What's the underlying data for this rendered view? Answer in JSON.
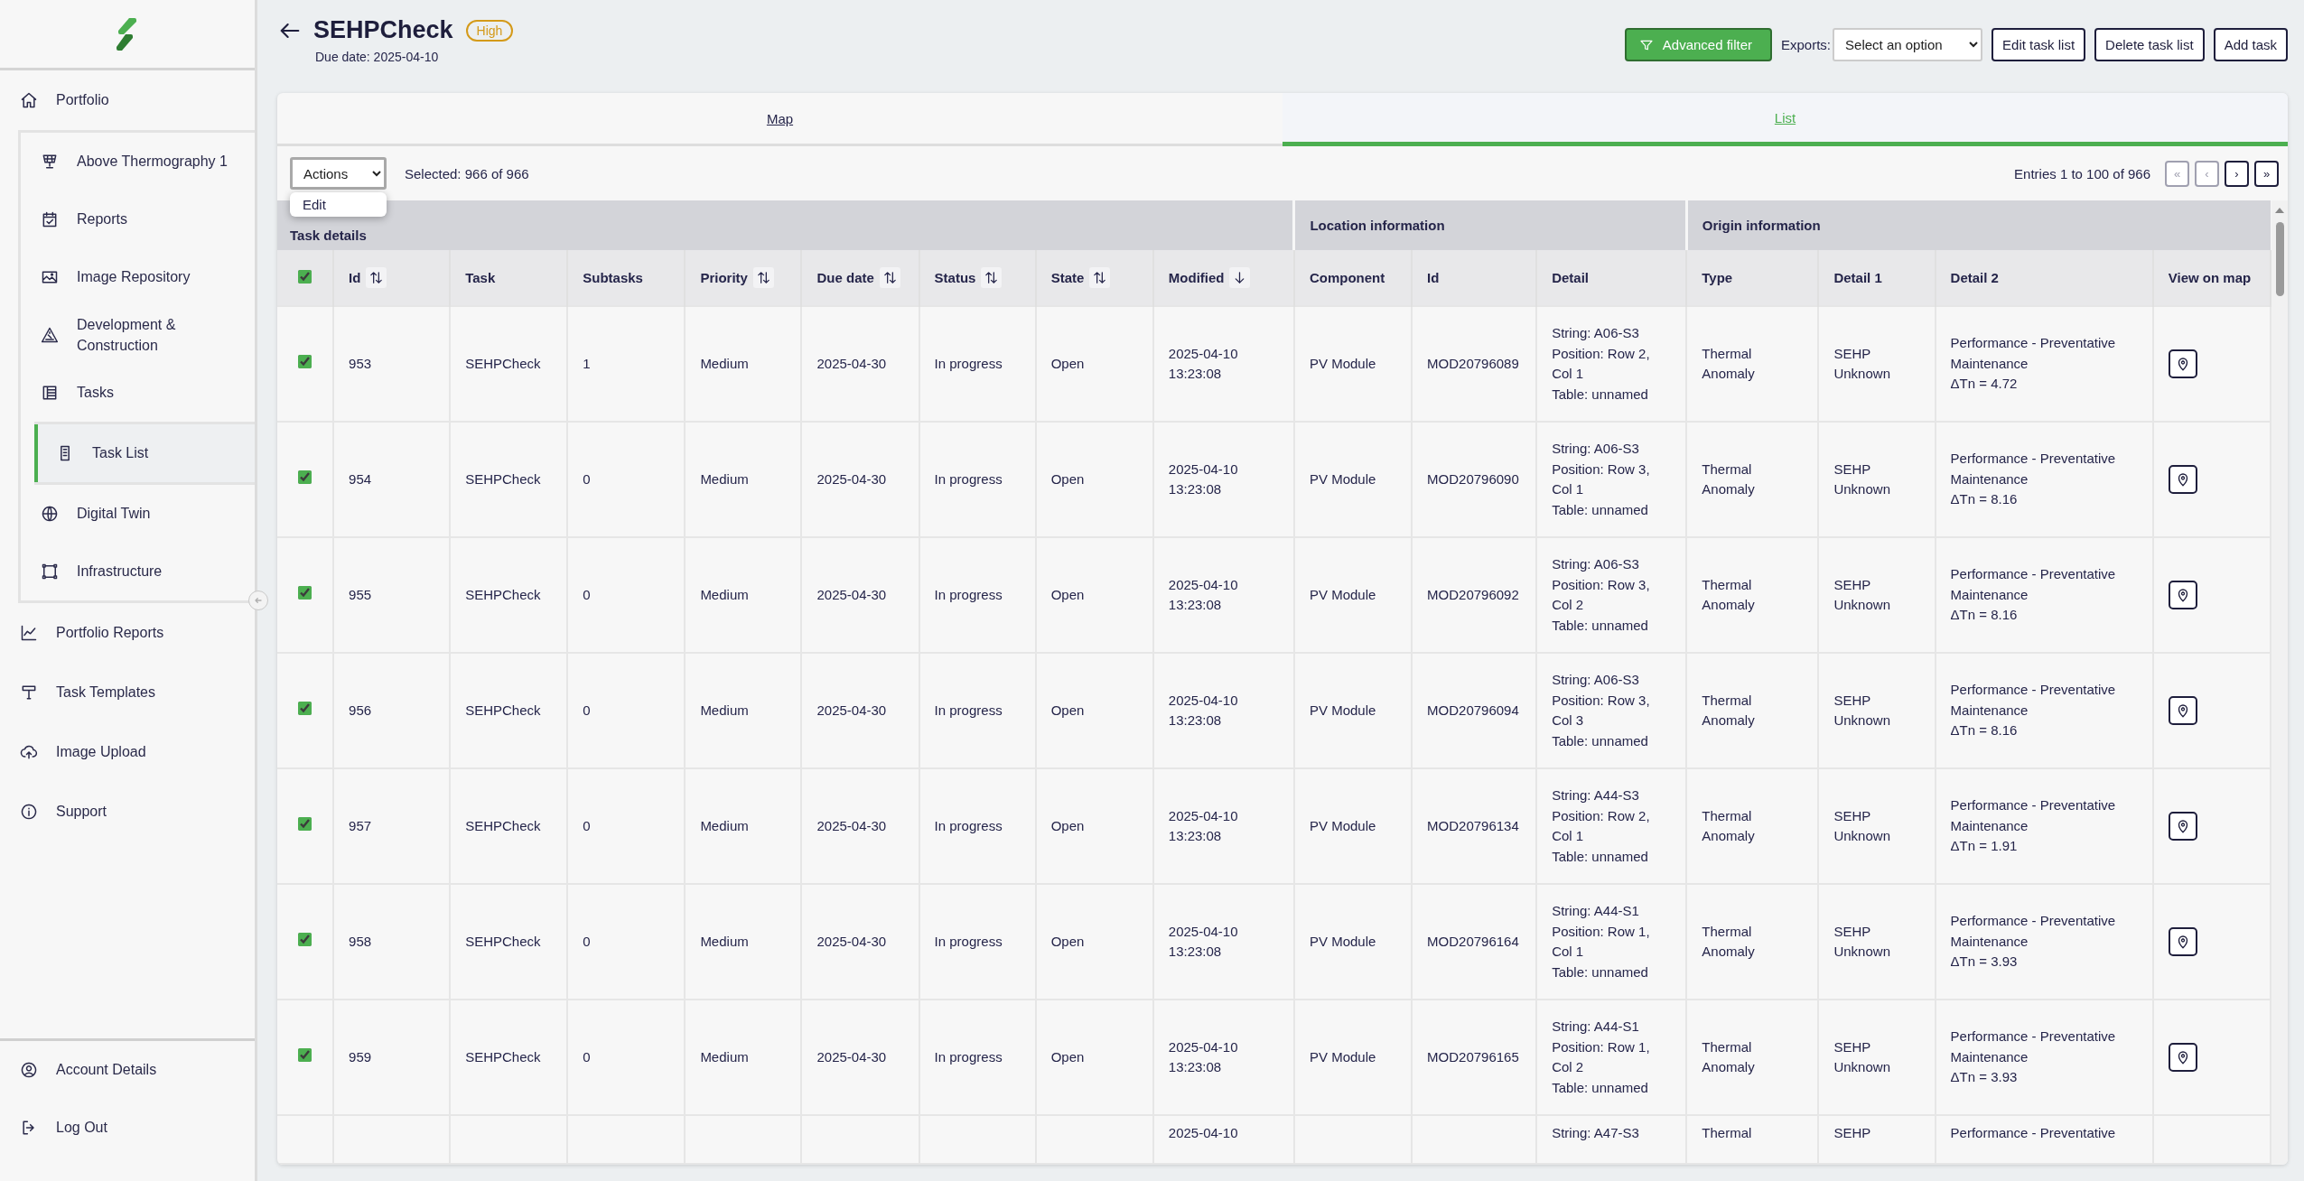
{
  "sidebar": {
    "items": [
      {
        "label": "Portfolio",
        "selected": false,
        "children": [
          {
            "label": "Above Thermography 1",
            "selected": false
          },
          {
            "label": "Reports",
            "selected": false
          },
          {
            "label": "Image Repository",
            "selected": false
          },
          {
            "label": "Development & Construction",
            "selected": false
          },
          {
            "label": "Tasks",
            "selected": false,
            "children": [
              {
                "label": "Task List",
                "selected": true
              }
            ]
          },
          {
            "label": "Digital Twin",
            "selected": false
          },
          {
            "label": "Infrastructure",
            "selected": false
          }
        ]
      },
      {
        "label": "Portfolio Reports",
        "selected": false
      },
      {
        "label": "Task Templates",
        "selected": false
      },
      {
        "label": "Image Upload",
        "selected": false
      },
      {
        "label": "Support",
        "selected": false
      }
    ],
    "footer": [
      {
        "label": "Account Details",
        "selected": false
      },
      {
        "label": "Log Out",
        "selected": false
      }
    ]
  },
  "header": {
    "title": "SEHPCheck",
    "priority": "High",
    "due_date": "Due date: 2025-04-10",
    "advanced_filter": "Advanced filter",
    "exports": {
      "label": "Exports:",
      "value": "Select an option"
    },
    "buttons": [
      "Edit task list",
      "Delete task list",
      "Add task"
    ]
  },
  "tabs": [
    {
      "label": "Map",
      "selected": false
    },
    {
      "label": "List",
      "selected": true
    }
  ],
  "list_toolbar": {
    "actions": {
      "value": "Actions",
      "expanded": true,
      "menu": [
        "Edit"
      ]
    },
    "selection": "Selected: 966 of 966",
    "entries": "Entries 1 to 100 of 966",
    "pager": [
      {
        "label": "«",
        "disabled": true
      },
      {
        "label": "‹",
        "disabled": true
      },
      {
        "label": "›",
        "disabled": false
      },
      {
        "label": "»",
        "disabled": false
      }
    ]
  },
  "table": {
    "groups": [
      {
        "title": "Task details",
        "columns": [
          {
            "kind": "select",
            "checked": true
          },
          {
            "kind": "text",
            "label": "Id",
            "sortable": true,
            "sorted": false
          },
          {
            "kind": "text",
            "label": "Task"
          },
          {
            "kind": "text",
            "label": "Subtasks"
          },
          {
            "kind": "text",
            "label": "Priority",
            "sortable": true,
            "sorted": false
          },
          {
            "kind": "text",
            "label": "Due date",
            "sortable": true,
            "sorted": false
          },
          {
            "kind": "text",
            "label": "Status",
            "sortable": true,
            "sorted": false
          },
          {
            "kind": "text",
            "label": "State",
            "sortable": true,
            "sorted": false
          },
          {
            "kind": "text",
            "label": "Modified",
            "sortable": true,
            "sorted": true
          }
        ]
      },
      {
        "title": "Location information",
        "columns": [
          {
            "kind": "text",
            "label": "Component"
          },
          {
            "kind": "text",
            "label": "Id"
          },
          {
            "kind": "text",
            "label": "Detail"
          }
        ]
      },
      {
        "title": "Origin information",
        "columns": [
          {
            "kind": "text",
            "label": "Type"
          },
          {
            "kind": "text",
            "label": "Detail 1"
          },
          {
            "kind": "text",
            "label": "Detail 2"
          },
          {
            "kind": "map",
            "label": "View on map"
          }
        ]
      }
    ],
    "rows": [
      {
        "kind": "full",
        "checked": true,
        "cells": [
          "953",
          "SEHPCheck",
          "1",
          "Medium",
          "2025-04-30",
          "In progress",
          "Open",
          "2025-04-10 13:23:08",
          "PV Module",
          "MOD20796089",
          [
            "String: A06-S3",
            "Position: Row 2, Col 1",
            "Table: unnamed"
          ],
          "Thermal Anomaly",
          "SEHP Unknown",
          [
            "Performance - Preventative Maintenance",
            "ΔTn = 4.72"
          ]
        ]
      },
      {
        "kind": "full",
        "checked": true,
        "cells": [
          "954",
          "SEHPCheck",
          "0",
          "Medium",
          "2025-04-30",
          "In progress",
          "Open",
          "2025-04-10 13:23:08",
          "PV Module",
          "MOD20796090",
          [
            "String: A06-S3",
            "Position: Row 3, Col 1",
            "Table: unnamed"
          ],
          "Thermal Anomaly",
          "SEHP Unknown",
          [
            "Performance - Preventative Maintenance",
            "ΔTn = 8.16"
          ]
        ]
      },
      {
        "kind": "full",
        "checked": true,
        "cells": [
          "955",
          "SEHPCheck",
          "0",
          "Medium",
          "2025-04-30",
          "In progress",
          "Open",
          "2025-04-10 13:23:08",
          "PV Module",
          "MOD20796092",
          [
            "String: A06-S3",
            "Position: Row 3, Col 2",
            "Table: unnamed"
          ],
          "Thermal Anomaly",
          "SEHP Unknown",
          [
            "Performance - Preventative Maintenance",
            "ΔTn = 8.16"
          ]
        ]
      },
      {
        "kind": "full",
        "checked": true,
        "cells": [
          "956",
          "SEHPCheck",
          "0",
          "Medium",
          "2025-04-30",
          "In progress",
          "Open",
          "2025-04-10 13:23:08",
          "PV Module",
          "MOD20796094",
          [
            "String: A06-S3",
            "Position: Row 3, Col 3",
            "Table: unnamed"
          ],
          "Thermal Anomaly",
          "SEHP Unknown",
          [
            "Performance - Preventative Maintenance",
            "ΔTn = 8.16"
          ]
        ]
      },
      {
        "kind": "full",
        "checked": true,
        "cells": [
          "957",
          "SEHPCheck",
          "0",
          "Medium",
          "2025-04-30",
          "In progress",
          "Open",
          "2025-04-10 13:23:08",
          "PV Module",
          "MOD20796134",
          [
            "String: A44-S3",
            "Position: Row 2, Col 1",
            "Table: unnamed"
          ],
          "Thermal Anomaly",
          "SEHP Unknown",
          [
            "Performance - Preventative Maintenance",
            "ΔTn = 1.91"
          ]
        ]
      },
      {
        "kind": "full",
        "checked": true,
        "cells": [
          "958",
          "SEHPCheck",
          "0",
          "Medium",
          "2025-04-30",
          "In progress",
          "Open",
          "2025-04-10 13:23:08",
          "PV Module",
          "MOD20796164",
          [
            "String: A44-S1",
            "Position: Row 1, Col 1",
            "Table: unnamed"
          ],
          "Thermal Anomaly",
          "SEHP Unknown",
          [
            "Performance - Preventative Maintenance",
            "ΔTn = 3.93"
          ]
        ]
      },
      {
        "kind": "full",
        "checked": true,
        "cells": [
          "959",
          "SEHPCheck",
          "0",
          "Medium",
          "2025-04-30",
          "In progress",
          "Open",
          "2025-04-10 13:23:08",
          "PV Module",
          "MOD20796165",
          [
            "String: A44-S1",
            "Position: Row 1, Col 2",
            "Table: unnamed"
          ],
          "Thermal Anomaly",
          "SEHP Unknown",
          [
            "Performance - Preventative Maintenance",
            "ΔTn = 3.93"
          ]
        ]
      },
      {
        "kind": "partial",
        "cells": [
          null,
          null,
          null,
          null,
          null,
          null,
          null,
          "2025-04-10",
          null,
          null,
          [
            "String: A47-S3"
          ],
          "Thermal",
          "SEHP",
          [
            "Performance - Preventative"
          ]
        ]
      }
    ]
  }
}
